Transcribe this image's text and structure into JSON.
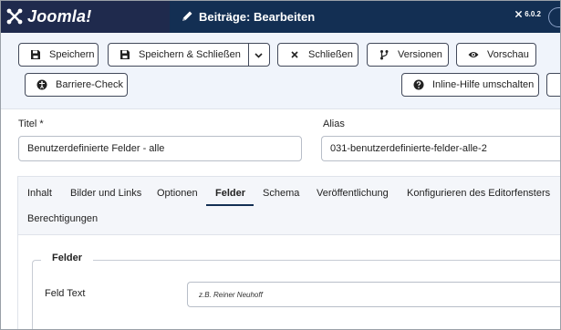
{
  "header": {
    "brand": "Joomla!",
    "page_title": "Beiträge: Bearbeiten",
    "version": "6.0.2",
    "colors": {
      "logo_bg": "#1f2a4d",
      "bar_bg": "#132f53"
    }
  },
  "toolbar": {
    "save": {
      "label": "Speichern",
      "icon": "floppy-disk-icon"
    },
    "save_close": {
      "label": "Speichern & Schließen",
      "icon": "floppy-disk-icon",
      "dropdown_icon": "chevron-down-icon"
    },
    "close": {
      "label": "Schließen",
      "icon": "close-icon"
    },
    "versions": {
      "label": "Versionen",
      "icon": "code-branch-icon"
    },
    "preview": {
      "label": "Vorschau",
      "icon": "eye-icon"
    },
    "accessibility_check": {
      "label": "Barriere-Check",
      "icon": "accessibility-icon"
    },
    "inline_help": {
      "label": "Inline-Hilfe umschalten",
      "icon": "question-circle-icon"
    }
  },
  "form": {
    "title_label": "Titel *",
    "title_value": "Benutzerdefinierte Felder - alle",
    "alias_label": "Alias",
    "alias_value": "031-benutzerdefinierte-felder-alle-2"
  },
  "tabs": [
    {
      "label": "Inhalt",
      "active": false
    },
    {
      "label": "Bilder und Links",
      "active": false
    },
    {
      "label": "Optionen",
      "active": false
    },
    {
      "label": "Felder",
      "active": true
    },
    {
      "label": "Schema",
      "active": false
    },
    {
      "label": "Veröffentlichung",
      "active": false
    },
    {
      "label": "Konfigurieren des Editorfensters",
      "active": false
    },
    {
      "label": "Berechtigungen",
      "active": false
    }
  ],
  "fields_panel": {
    "legend": "Felder",
    "field_label": "Feld Text",
    "field_placeholder": "z.B. Reiner Neuhoff"
  }
}
